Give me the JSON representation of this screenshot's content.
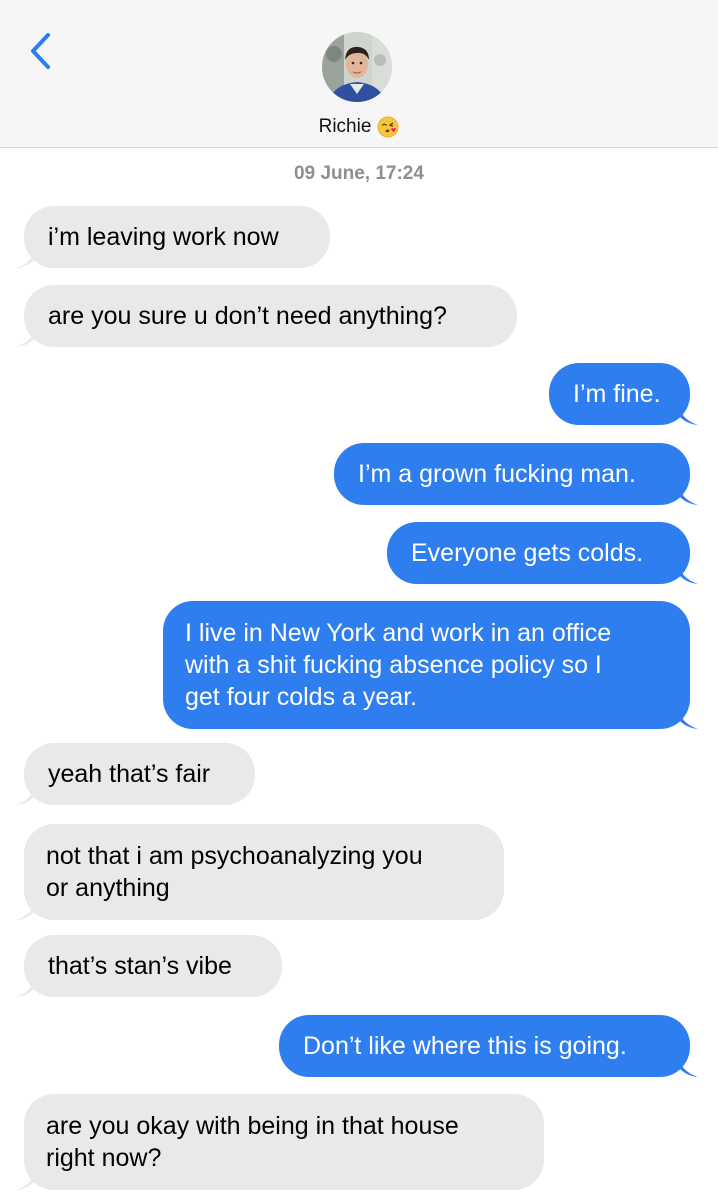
{
  "header": {
    "contact_name": "Richie",
    "back_icon": "chevron-left-icon",
    "contact_emoji": "kissing-face-with-heart-emoji",
    "accent": "#2f7ef0"
  },
  "timestamp": "09 June, 17:24",
  "messages": [
    {
      "direction": "incoming",
      "lines": [
        "i’m leaving work now"
      ]
    },
    {
      "direction": "incoming",
      "lines": [
        "are you sure u don’t need anything?"
      ]
    },
    {
      "direction": "outgoing",
      "lines": [
        "I’m fine."
      ]
    },
    {
      "direction": "outgoing",
      "lines": [
        "I’m a grown fucking man."
      ]
    },
    {
      "direction": "outgoing",
      "lines": [
        "Everyone gets colds."
      ]
    },
    {
      "direction": "outgoing",
      "lines": [
        "I live in New York and work in an office",
        "with a shit fucking absence policy so I",
        "get four colds a year."
      ]
    },
    {
      "direction": "incoming",
      "lines": [
        "yeah that’s fair"
      ]
    },
    {
      "direction": "incoming",
      "lines": [
        "not that i am psychoanalyzing you",
        "or anything"
      ]
    },
    {
      "direction": "incoming",
      "lines": [
        "that’s stan’s vibe"
      ]
    },
    {
      "direction": "outgoing",
      "lines": [
        "Don’t like where this is going."
      ]
    },
    {
      "direction": "incoming",
      "lines": [
        "are you okay with being in that house",
        "right now?"
      ]
    }
  ]
}
